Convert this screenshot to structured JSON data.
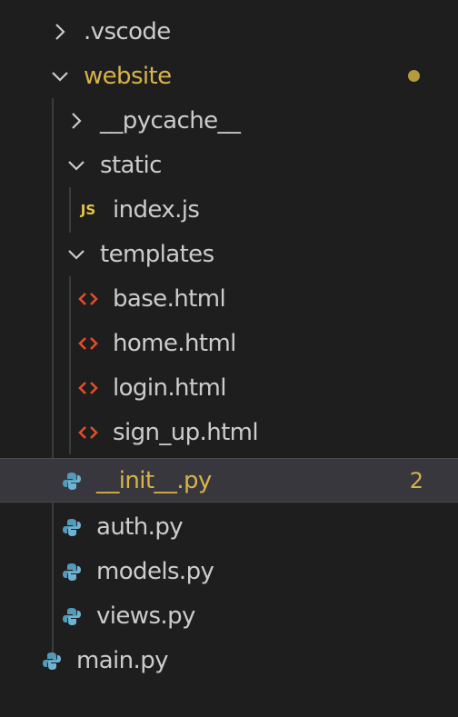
{
  "explorer": {
    "vscode_folder": ".vscode",
    "website_folder": "website",
    "website_status": "modified-dot",
    "pycache_folder": "__pycache__",
    "static_folder": "static",
    "index_js": "index.js",
    "js_badge": "JS",
    "templates_folder": "templates",
    "base_html": "base.html",
    "home_html": "home.html",
    "login_html": "login.html",
    "sign_up_html": "sign_up.html",
    "init_py": "__init__.py",
    "init_problems": "2",
    "auth_py": "auth.py",
    "models_py": "models.py",
    "views_py": "views.py",
    "main_py": "main.py"
  },
  "colors": {
    "background": "#1e1e1e",
    "text": "#cccccc",
    "modified": "#d7b34a",
    "selected_row": "#37373d",
    "html_icon": "#e44d26",
    "python_icon": "#519aba",
    "js_icon": "#e7c547"
  },
  "icons": {
    "collapsed": "chevron-right-icon",
    "expanded": "chevron-down-icon",
    "html_file": "html-file-icon",
    "python_file": "python-file-icon",
    "js_file": "js-file-icon"
  }
}
